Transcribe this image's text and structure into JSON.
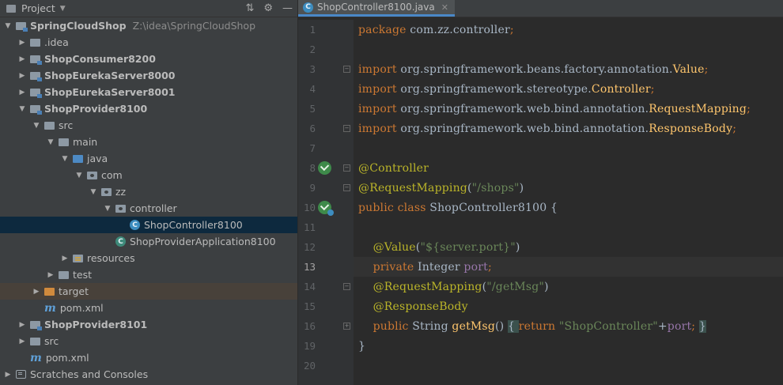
{
  "project_panel": {
    "title": "Project",
    "tree": [
      {
        "label": "SpringCloudShop",
        "path": "Z:\\idea\\SpringCloudShop",
        "depth": 0,
        "expanded": true,
        "icon": "module-folder-icon",
        "bold": true
      },
      {
        "label": ".idea",
        "depth": 1,
        "expanded": false,
        "icon": "folder-icon"
      },
      {
        "label": "ShopConsumer8200",
        "depth": 1,
        "expanded": false,
        "icon": "module-folder-icon",
        "bold": true
      },
      {
        "label": "ShopEurekaServer8000",
        "depth": 1,
        "expanded": false,
        "icon": "module-folder-icon",
        "bold": true
      },
      {
        "label": "ShopEurekaServer8001",
        "depth": 1,
        "expanded": false,
        "icon": "module-folder-icon",
        "bold": true
      },
      {
        "label": "ShopProvider8100",
        "depth": 1,
        "expanded": true,
        "icon": "module-folder-icon",
        "bold": true
      },
      {
        "label": "src",
        "depth": 2,
        "expanded": true,
        "icon": "folder-icon"
      },
      {
        "label": "main",
        "depth": 3,
        "expanded": true,
        "icon": "folder-icon"
      },
      {
        "label": "java",
        "depth": 4,
        "expanded": true,
        "icon": "source-folder-icon"
      },
      {
        "label": "com",
        "depth": 5,
        "expanded": true,
        "icon": "package-icon"
      },
      {
        "label": "zz",
        "depth": 6,
        "expanded": true,
        "icon": "package-icon"
      },
      {
        "label": "controller",
        "depth": 7,
        "expanded": true,
        "icon": "package-icon"
      },
      {
        "label": "ShopController8100",
        "depth": 8,
        "icon": "java-class-icon",
        "selected": true
      },
      {
        "label": "ShopProviderApplication8100",
        "depth": 7,
        "icon": "spring-boot-class-icon"
      },
      {
        "label": "resources",
        "depth": 4,
        "expanded": false,
        "icon": "resources-folder-icon"
      },
      {
        "label": "test",
        "depth": 3,
        "expanded": false,
        "icon": "folder-icon"
      },
      {
        "label": "target",
        "depth": 2,
        "expanded": false,
        "icon": "target-folder-icon",
        "excluded": true
      },
      {
        "label": "pom.xml",
        "depth": 2,
        "icon": "maven-icon"
      },
      {
        "label": "ShopProvider8101",
        "depth": 1,
        "expanded": false,
        "icon": "module-folder-icon",
        "bold": true
      },
      {
        "label": "src",
        "depth": 1,
        "expanded": false,
        "icon": "folder-icon"
      },
      {
        "label": "pom.xml",
        "depth": 1,
        "icon": "maven-icon"
      },
      {
        "label": "Scratches and Consoles",
        "depth": 0,
        "expanded": false,
        "icon": "scratches-icon"
      }
    ]
  },
  "editor": {
    "tab": {
      "label": "ShopController8100.java",
      "icon": "java-class-icon"
    },
    "current_line": 13,
    "lines": [
      {
        "n": "1",
        "tokens": [
          {
            "t": "package ",
            "c": "kw"
          },
          {
            "t": "com.zz.controller",
            "c": ""
          },
          {
            "t": ";",
            "c": "kw"
          }
        ]
      },
      {
        "n": "2",
        "tokens": []
      },
      {
        "n": "3",
        "fold": "open",
        "tokens": [
          {
            "t": "import ",
            "c": "kw"
          },
          {
            "t": "org.springframework.beans.factory.annotation.",
            "c": ""
          },
          {
            "t": "Value",
            "c": "fn"
          },
          {
            "t": ";",
            "c": "kw"
          }
        ]
      },
      {
        "n": "4",
        "tokens": [
          {
            "t": "import ",
            "c": "kw"
          },
          {
            "t": "org.springframework.stereotype.",
            "c": ""
          },
          {
            "t": "Controller",
            "c": "fn"
          },
          {
            "t": ";",
            "c": "kw"
          }
        ]
      },
      {
        "n": "5",
        "tokens": [
          {
            "t": "import ",
            "c": "kw"
          },
          {
            "t": "org.springframework.web.bind.annotation.",
            "c": ""
          },
          {
            "t": "RequestMapping",
            "c": "fn"
          },
          {
            "t": ";",
            "c": "kw"
          }
        ]
      },
      {
        "n": "6",
        "fold": "close",
        "tokens": [
          {
            "t": "import ",
            "c": "kw"
          },
          {
            "t": "org.springframework.web.bind.annotation.",
            "c": ""
          },
          {
            "t": "ResponseBody",
            "c": "fn"
          },
          {
            "t": ";",
            "c": "kw"
          }
        ]
      },
      {
        "n": "7",
        "tokens": []
      },
      {
        "n": "8",
        "fold": "open",
        "gutter_icon": "spring-bean-icon",
        "tokens": [
          {
            "t": "@Controller",
            "c": "ann"
          }
        ]
      },
      {
        "n": "9",
        "fold": "close",
        "tokens": [
          {
            "t": "@RequestMapping",
            "c": "ann"
          },
          {
            "t": "(",
            "c": ""
          },
          {
            "t": "\"/shops\"",
            "c": "str"
          },
          {
            "t": ")",
            "c": ""
          }
        ]
      },
      {
        "n": "10",
        "gutter_icon": "spring-bean-class-icon",
        "tokens": [
          {
            "t": "public class ",
            "c": "kw"
          },
          {
            "t": "ShopController8100 {",
            "c": ""
          }
        ]
      },
      {
        "n": "11",
        "tokens": []
      },
      {
        "n": "12",
        "tokens": [
          {
            "t": "    ",
            "c": ""
          },
          {
            "t": "@Value",
            "c": "ann"
          },
          {
            "t": "(",
            "c": ""
          },
          {
            "t": "\"${server.port}\"",
            "c": "str"
          },
          {
            "t": ")",
            "c": ""
          }
        ]
      },
      {
        "n": "13",
        "tokens": [
          {
            "t": "    ",
            "c": ""
          },
          {
            "t": "private ",
            "c": "kw"
          },
          {
            "t": "Integer ",
            "c": ""
          },
          {
            "t": "port",
            "c": "field"
          },
          {
            "t": ";",
            "c": "kw"
          }
        ]
      },
      {
        "n": "14",
        "fold": "open",
        "tokens": [
          {
            "t": "    ",
            "c": ""
          },
          {
            "t": "@RequestMapping",
            "c": "ann"
          },
          {
            "t": "(",
            "c": ""
          },
          {
            "t": "\"/getMsg\"",
            "c": "str"
          },
          {
            "t": ")",
            "c": ""
          }
        ]
      },
      {
        "n": "15",
        "tokens": [
          {
            "t": "    ",
            "c": ""
          },
          {
            "t": "@ResponseBody",
            "c": "ann"
          }
        ]
      },
      {
        "n": "16",
        "fold": "plus",
        "tokens": [
          {
            "t": "    ",
            "c": ""
          },
          {
            "t": "public ",
            "c": "kw"
          },
          {
            "t": "String ",
            "c": ""
          },
          {
            "t": "getMsg",
            "c": "fn"
          },
          {
            "t": "() ",
            "c": ""
          },
          {
            "t": "{ ",
            "c": "brace"
          },
          {
            "t": "return ",
            "c": "kw"
          },
          {
            "t": "\"ShopController\"",
            "c": "str"
          },
          {
            "t": "+",
            "c": ""
          },
          {
            "t": "port",
            "c": "field"
          },
          {
            "t": "; ",
            "c": "kw"
          },
          {
            "t": "}",
            "c": "brace"
          }
        ]
      },
      {
        "n": "19",
        "tokens": [
          {
            "t": "}",
            "c": ""
          }
        ]
      },
      {
        "n": "20",
        "tokens": []
      }
    ]
  }
}
